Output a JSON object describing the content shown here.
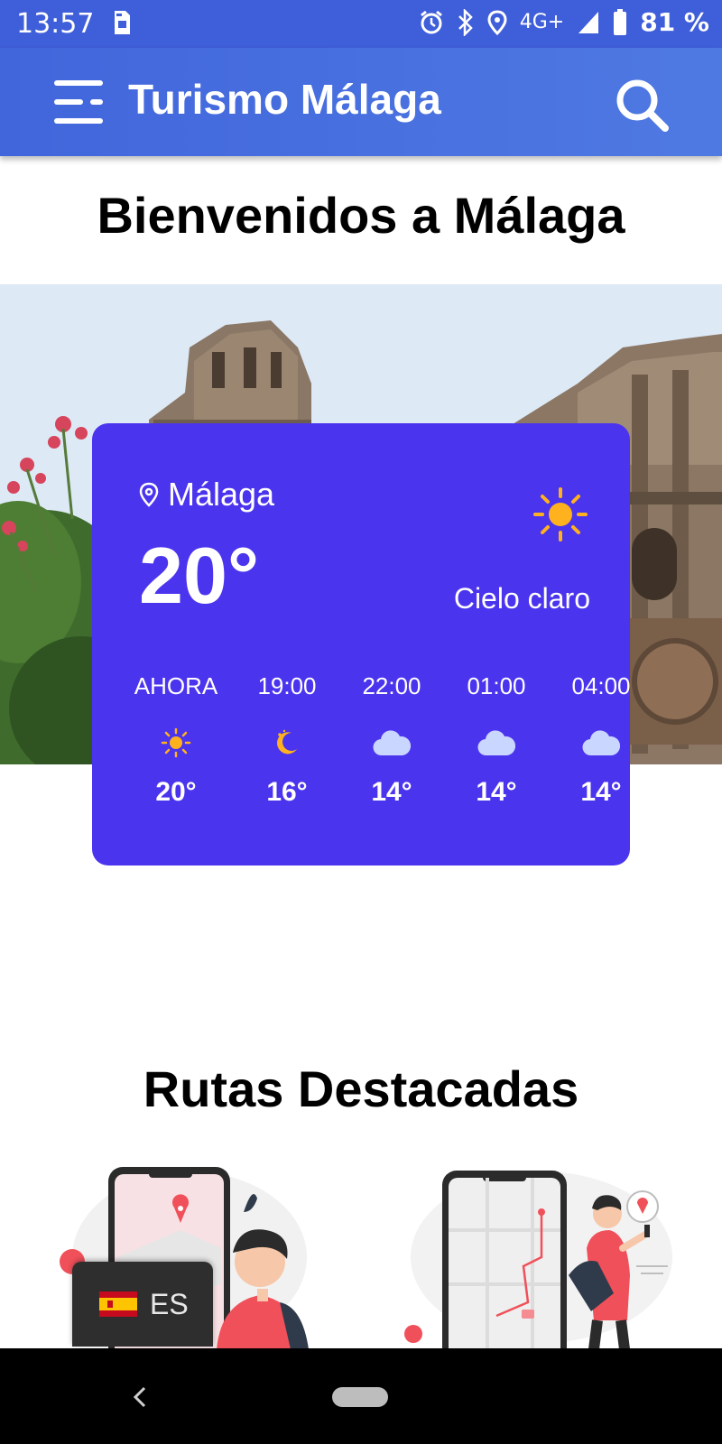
{
  "status_bar": {
    "time": "13:57",
    "network": "4G+",
    "battery": "81 %",
    "icons": [
      "sim-card-icon",
      "alarm-icon",
      "bluetooth-icon",
      "location-icon",
      "signal-icon",
      "battery-icon"
    ]
  },
  "app_bar": {
    "title": "Turismo Málaga",
    "menu_icon": "menu-icon",
    "search_icon": "search-icon"
  },
  "welcome": {
    "title": "Bienvenidos a Málaga"
  },
  "weather": {
    "location": "Málaga",
    "temperature": "20°",
    "condition": "Cielo claro",
    "accent": "#4b34ee",
    "hourly": [
      {
        "label": "AHORA",
        "icon": "sun-icon",
        "temp": "20°"
      },
      {
        "label": "19:00",
        "icon": "moon-icon",
        "temp": "16°"
      },
      {
        "label": "22:00",
        "icon": "cloud-icon",
        "temp": "14°"
      },
      {
        "label": "01:00",
        "icon": "cloud-icon",
        "temp": "14°"
      },
      {
        "label": "04:00",
        "icon": "cloud-icon",
        "temp": "14°"
      }
    ]
  },
  "featured_routes": {
    "title": "Rutas Destacadas"
  },
  "language": {
    "code": "ES",
    "flag_icon": "spain-flag-icon"
  },
  "brand_colors": {
    "app_bar": "#4166dc",
    "weather_card": "#4b34ee",
    "accent_red": "#f0505a"
  }
}
